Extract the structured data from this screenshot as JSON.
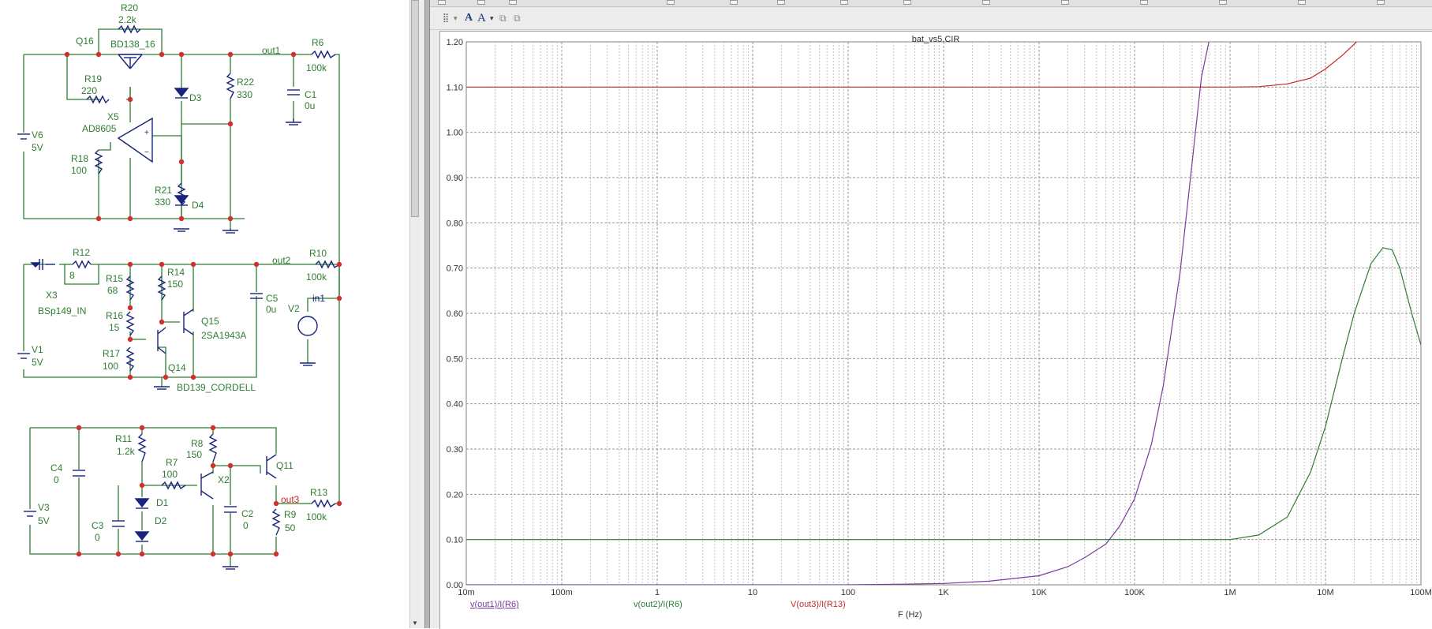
{
  "schematic": {
    "components": {
      "R20": {
        "ref": "R20",
        "value": "2.2k"
      },
      "Q16": {
        "ref": "Q16",
        "model": "BD138_16"
      },
      "R19": {
        "ref": "R19",
        "value": "220"
      },
      "X5": {
        "ref": "X5",
        "model": "AD8605"
      },
      "V6": {
        "ref": "V6",
        "value": "5V"
      },
      "R18": {
        "ref": "R18",
        "value": "100"
      },
      "R21": {
        "ref": "R21",
        "value": "330"
      },
      "D3": {
        "ref": "D3"
      },
      "D4": {
        "ref": "D4"
      },
      "R22": {
        "ref": "R22",
        "value": "330"
      },
      "C1": {
        "ref": "C1",
        "value": "0u"
      },
      "R6": {
        "ref": "R6",
        "value": "100k"
      },
      "R12": {
        "ref": "R12",
        "value": "8"
      },
      "X3": {
        "ref": "X3",
        "model": "BSp149_IN"
      },
      "R15": {
        "ref": "R15",
        "value": "68"
      },
      "R14": {
        "ref": "R14",
        "value": "150"
      },
      "R16": {
        "ref": "R16",
        "value": "15"
      },
      "R17": {
        "ref": "R17",
        "value": "100"
      },
      "Q15": {
        "ref": "Q15",
        "model": "2SA1943A"
      },
      "Q14": {
        "ref": "Q14",
        "model": "BD139_CORDELL"
      },
      "V1": {
        "ref": "V1",
        "value": "5V"
      },
      "C5": {
        "ref": "C5",
        "value": "0u"
      },
      "R10": {
        "ref": "R10",
        "value": "100k"
      },
      "V2": {
        "ref": "V2"
      },
      "C4": {
        "ref": "C4",
        "value": "0"
      },
      "R11": {
        "ref": "R11",
        "value": "1.2k"
      },
      "R8": {
        "ref": "R8",
        "value": "150"
      },
      "R7": {
        "ref": "R7",
        "value": "100"
      },
      "X2": {
        "ref": "X2"
      },
      "Q11": {
        "ref": "Q11"
      },
      "D1": {
        "ref": "D1"
      },
      "D2": {
        "ref": "D2"
      },
      "C3": {
        "ref": "C3",
        "value": "0"
      },
      "C2": {
        "ref": "C2",
        "value": "0"
      },
      "R9": {
        "ref": "R9",
        "value": "50"
      },
      "R13": {
        "ref": "R13",
        "value": "100k"
      },
      "V3": {
        "ref": "V3",
        "value": "5V"
      }
    },
    "nets": {
      "out1": "out1",
      "out2": "out2",
      "out3": "out3",
      "in1": "in1"
    },
    "colors": {
      "wire": "#2e7d32",
      "component": "#1a237e",
      "node": "#d32f2f",
      "label": "#2e7d32",
      "net": "#2e7d32",
      "out3": "#c62828",
      "in1": "#1a237e"
    }
  },
  "plot": {
    "title": "bat_vs5.CIR",
    "x_axis_label": "F (Hz)",
    "legend": [
      {
        "text": "v(out1)/I(R6)",
        "color": "#7b3a9e"
      },
      {
        "text": "v(out2)/I(R6)",
        "color": "#2e7d32"
      },
      {
        "text": "V(out3)/I(R13)",
        "color": "#c62828"
      }
    ]
  },
  "chart_data": {
    "type": "line",
    "title": "bat_vs5.CIR",
    "xlabel": "F (Hz)",
    "ylabel": "",
    "xscale": "log",
    "xlim": [
      0.01,
      100000000
    ],
    "ylim": [
      0.0,
      1.2
    ],
    "grid": true,
    "legend_placement": "bottom-left",
    "x_tick_labels": [
      "10m",
      "100m",
      "1",
      "10",
      "100",
      "1K",
      "10K",
      "100K",
      "1M",
      "10M",
      "100M"
    ],
    "x_ticks": [
      0.01,
      0.1,
      1,
      10,
      100,
      1000,
      10000,
      100000,
      1000000,
      10000000,
      100000000
    ],
    "y_ticks": [
      0.0,
      0.1,
      0.2,
      0.3,
      0.4,
      0.5,
      0.6,
      0.7,
      0.8,
      0.9,
      1.0,
      1.1,
      1.2
    ],
    "y_tick_labels": [
      "0.00",
      "0.10",
      "0.20",
      "0.30",
      "0.40",
      "0.50",
      "0.60",
      "0.70",
      "0.80",
      "0.90",
      "1.00",
      "1.10",
      "1.20"
    ],
    "series": [
      {
        "name": "v(out1)/I(R6)",
        "color": "#7b3a9e",
        "x": [
          0.01,
          1,
          100,
          300,
          1000,
          3000,
          10000,
          20000,
          30000,
          50000,
          70000,
          100000,
          150000,
          200000,
          300000,
          400000,
          500000,
          600000,
          650000
        ],
        "y": [
          0.0,
          0.0,
          0.0,
          0.001,
          0.003,
          0.008,
          0.02,
          0.04,
          0.06,
          0.09,
          0.13,
          0.19,
          0.31,
          0.44,
          0.69,
          0.93,
          1.12,
          1.2,
          1.26
        ]
      },
      {
        "name": "v(out2)/I(R6)",
        "color": "#2e7d32",
        "x": [
          0.01,
          1,
          100,
          10000,
          100000,
          1000000,
          2000000,
          4000000,
          7000000,
          10000000,
          15000000,
          20000000,
          30000000,
          40000000,
          50000000,
          60000000,
          80000000,
          100000000
        ],
        "y": [
          0.1,
          0.1,
          0.1,
          0.1,
          0.1,
          0.1,
          0.11,
          0.15,
          0.25,
          0.35,
          0.5,
          0.6,
          0.71,
          0.745,
          0.74,
          0.7,
          0.6,
          0.53
        ]
      },
      {
        "name": "V(out3)/I(R13)",
        "color": "#c62828",
        "x": [
          0.01,
          1,
          100,
          10000,
          100000,
          1000000,
          2000000,
          4000000,
          7000000,
          10000000,
          15000000,
          20000000,
          25000000
        ],
        "y": [
          1.1,
          1.1,
          1.1,
          1.1,
          1.1,
          1.1,
          1.101,
          1.107,
          1.12,
          1.14,
          1.17,
          1.195,
          1.215
        ]
      }
    ]
  }
}
